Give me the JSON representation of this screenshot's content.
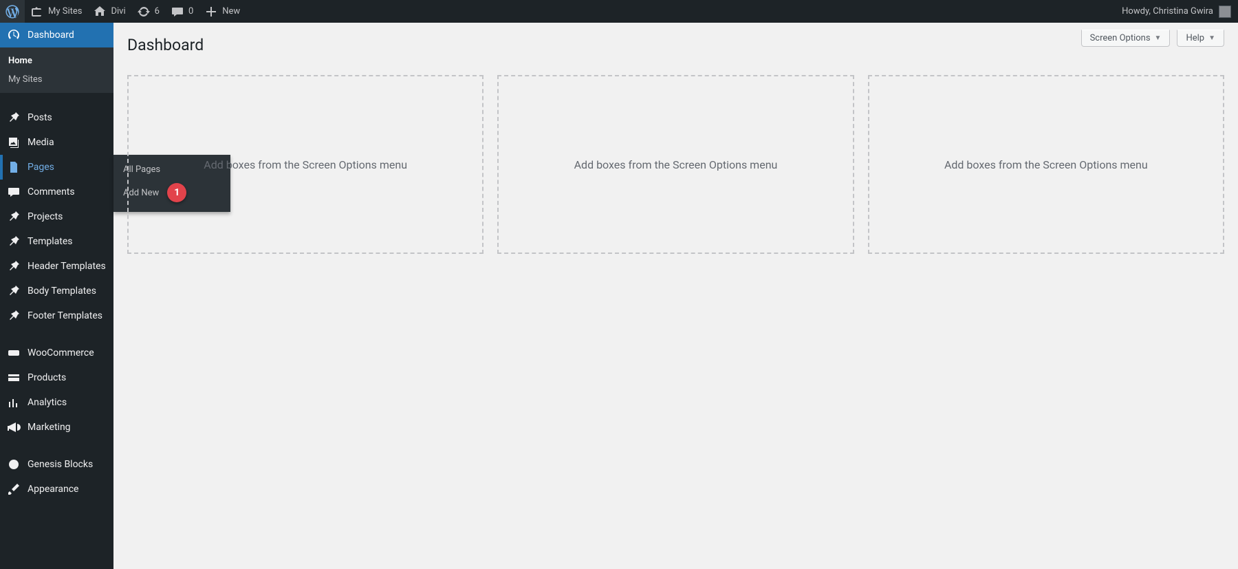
{
  "adminbar": {
    "my_sites": "My Sites",
    "site_name": "Divi",
    "updates": "6",
    "comments": "0",
    "new": "New",
    "howdy": "Howdy, Christina Gwira"
  },
  "sidebar": {
    "dashboard": "Dashboard",
    "dashboard_sub_home": "Home",
    "dashboard_sub_mysites": "My Sites",
    "posts": "Posts",
    "media": "Media",
    "pages": "Pages",
    "pages_fly_all": "All Pages",
    "pages_fly_addnew": "Add New",
    "pages_fly_badge": "1",
    "comments": "Comments",
    "projects": "Projects",
    "templates": "Templates",
    "header_templates": "Header Templates",
    "body_templates": "Body Templates",
    "footer_templates": "Footer Templates",
    "woocommerce": "WooCommerce",
    "products": "Products",
    "analytics": "Analytics",
    "marketing": "Marketing",
    "genesis_blocks": "Genesis Blocks",
    "appearance": "Appearance"
  },
  "content": {
    "title": "Dashboard",
    "screen_options": "Screen Options",
    "help": "Help",
    "empty_box_msg": "Add boxes from the Screen Options menu"
  }
}
